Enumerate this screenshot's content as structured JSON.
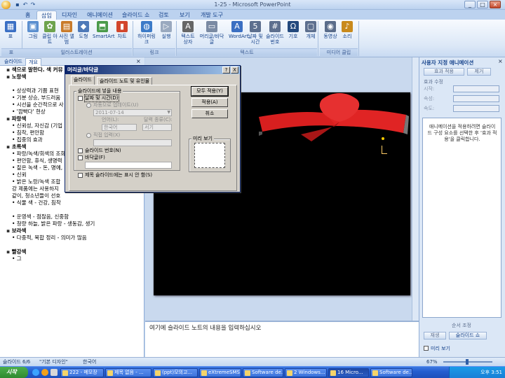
{
  "window": {
    "title": "1-25 - Microsoft PowerPoint",
    "min": "_",
    "max": "□",
    "close": "×"
  },
  "ribbon_tabs": [
    "홈",
    "삽입",
    "디자인",
    "애니메이션",
    "슬라이드 쇼",
    "검토",
    "보기",
    "개발 도구"
  ],
  "active_tab_index": 1,
  "ribbon": {
    "buttons": [
      {
        "label": "표",
        "icon": "table-icon",
        "glyph": "▦",
        "color": "#3a6fc4"
      },
      {
        "label": "그림",
        "icon": "picture-icon",
        "glyph": "▣",
        "color": "#5b8fcf"
      },
      {
        "label": "클립 아트",
        "icon": "clipart-icon",
        "glyph": "✿",
        "color": "#6da34d"
      },
      {
        "label": "사진 앨범",
        "icon": "photo-album-icon",
        "glyph": "▤",
        "color": "#c97b2a"
      },
      {
        "label": "도형",
        "icon": "shapes-icon",
        "glyph": "◆",
        "color": "#4e79b8"
      },
      {
        "label": "SmartArt",
        "icon": "smartart-icon",
        "glyph": "⬒",
        "color": "#4a9a4a"
      },
      {
        "label": "차트",
        "icon": "chart-icon",
        "glyph": "▮",
        "color": "#d2462c"
      },
      {
        "label": "하이퍼링크",
        "icon": "hyperlink-icon",
        "glyph": "◍",
        "color": "#3d7bc8"
      },
      {
        "label": "실행",
        "icon": "action-icon",
        "glyph": "▷",
        "color": "#9aa9bf"
      },
      {
        "label": "텍스트 상자",
        "icon": "textbox-icon",
        "glyph": "A",
        "color": "#666"
      },
      {
        "label": "머리글/바닥글",
        "icon": "header-footer-icon",
        "glyph": "▭",
        "color": "#7a8aa3"
      },
      {
        "label": "WordArt",
        "icon": "wordart-icon",
        "glyph": "A",
        "color": "#3b6fc2"
      },
      {
        "label": "날짜 및 시간",
        "icon": "date-time-icon",
        "glyph": "5",
        "color": "#5d6f8e"
      },
      {
        "label": "슬라이드 번호",
        "icon": "slide-number-icon",
        "glyph": "#",
        "color": "#5d6f8e"
      },
      {
        "label": "기호",
        "icon": "symbol-icon",
        "glyph": "Ω",
        "color": "#23497d"
      },
      {
        "label": "개체",
        "icon": "object-icon",
        "glyph": "▢",
        "color": "#5d6f8e"
      },
      {
        "label": "동영상",
        "icon": "movie-icon",
        "glyph": "◉",
        "color": "#5a6c8a"
      },
      {
        "label": "소리",
        "icon": "sound-icon",
        "glyph": "♪",
        "color": "#c98a1c"
      }
    ],
    "groups": [
      "표",
      "일러스트레이션",
      "링크",
      "텍스트",
      "미디어 클립"
    ]
  },
  "left_panel": {
    "tabs": [
      "슬라이드",
      "개요"
    ],
    "lines": [
      {
        "text": "색으로 말한다. 색 커뮤",
        "kind": "title"
      },
      {
        "text": "노랑색",
        "kind": "head"
      },
      {
        "text": "",
        "kind": "blank"
      },
      {
        "text": "• 상상력과 기쁨 표현",
        "kind": "item"
      },
      {
        "text": "• 기분 상승, 부드러움",
        "kind": "item"
      },
      {
        "text": "• 시선을 순간적으로 사",
        "kind": "item"
      },
      {
        "text": "• '깜빡다' 현상",
        "kind": "item"
      },
      {
        "text": "파랑색",
        "kind": "head"
      },
      {
        "text": "• 신뢰성, 자신감 (기업",
        "kind": "item"
      },
      {
        "text": "• 침착, 편안함",
        "kind": "item"
      },
      {
        "text": "• 집중의 효과",
        "kind": "item"
      },
      {
        "text": "초록색",
        "kind": "head"
      },
      {
        "text": "• 파랑/녹색/회색의 조화",
        "kind": "item"
      },
      {
        "text": "• 편안함, 휴식, 생명력",
        "kind": "item"
      },
      {
        "text": "• 짙은 녹색 - 돈, 명예,",
        "kind": "item"
      },
      {
        "text": "• 신뢰",
        "kind": "item"
      },
      {
        "text": "• 밝은 노랑/녹색 조합",
        "kind": "item"
      },
      {
        "text": "  강 제품에는 사용하지",
        "kind": "item"
      },
      {
        "text": "  같이, 청소년들이 선호",
        "kind": "item"
      },
      {
        "text": "• 식물 색 - 건강, 침착",
        "kind": "item"
      },
      {
        "text": "",
        "kind": "blank"
      },
      {
        "text": "• 운영색 - 점잖음, 신중함",
        "kind": "item"
      },
      {
        "text": "• 청량 하늘, 밝은 파랑 - 생동감, 생기",
        "kind": "item"
      },
      {
        "text": "보라색",
        "kind": "head"
      },
      {
        "text": "• 다중적, 복합 정리 - 의미가 많음",
        "kind": "item"
      },
      {
        "text": "",
        "kind": "blank"
      },
      {
        "text": "빨강색",
        "kind": "head"
      },
      {
        "text": "• 그",
        "kind": "item"
      }
    ]
  },
  "notes": {
    "placeholder": "여기에 슬라이드 노트의 내용을 입력하십시오"
  },
  "task_pane": {
    "title": "사용자 지정 애니메이션",
    "add_effect": "효과 적용",
    "remove": "제거",
    "section": "효과 수정",
    "field_start": "시작:",
    "field_property": "속성:",
    "field_speed": "속도:",
    "hint": "애니메이션을 적용하려면 슬라이드 구성 요소를 선택한 후 '효과 적용'을 클릭합니다.",
    "reorder": "순서 조정",
    "play": "재생",
    "slideshow": "슬라이드 쇼",
    "autopreview": "미리 보기"
  },
  "status": {
    "slide": "슬라이드 6/6",
    "theme": "\"기본 디자인\"",
    "lang": "한국어",
    "zoom": "67%"
  },
  "taskbar": {
    "start": "시작",
    "items": [
      "222 - 메모장",
      "제목 없음 - ...",
      "(ppt)모의고...",
      "eXtremeSMS",
      "Software de...",
      "2 Windows...",
      "16 Micro...",
      "Software de..."
    ],
    "active_index": 6,
    "clock": "오후 3:51"
  },
  "dialog": {
    "title": "머리글/바닥글",
    "help": "?",
    "close": "X",
    "tabs": [
      "슬라이드",
      "슬라이드 노트 및 유인물"
    ],
    "group_label": "슬라이드에 넣을 내용",
    "date_time": "날짜 및 시간(D)",
    "auto_update": "자동으로 업데이트(U)",
    "date_value": "2011-07-14",
    "lang_label": "언어(L):",
    "lang_value": "한국어",
    "calendar_label": "달력 종류(C):",
    "calendar_value": "서기",
    "fixed": "직접 입력(X)",
    "slide_number": "슬라이드 번호(N)",
    "footer": "바닥글(F)",
    "no_title_slide": "제목 슬라이드에는 표시 안 함(S)",
    "apply_all": "모두 적용(Y)",
    "apply": "적용(A)",
    "cancel": "취소",
    "preview": "미리 보기"
  }
}
